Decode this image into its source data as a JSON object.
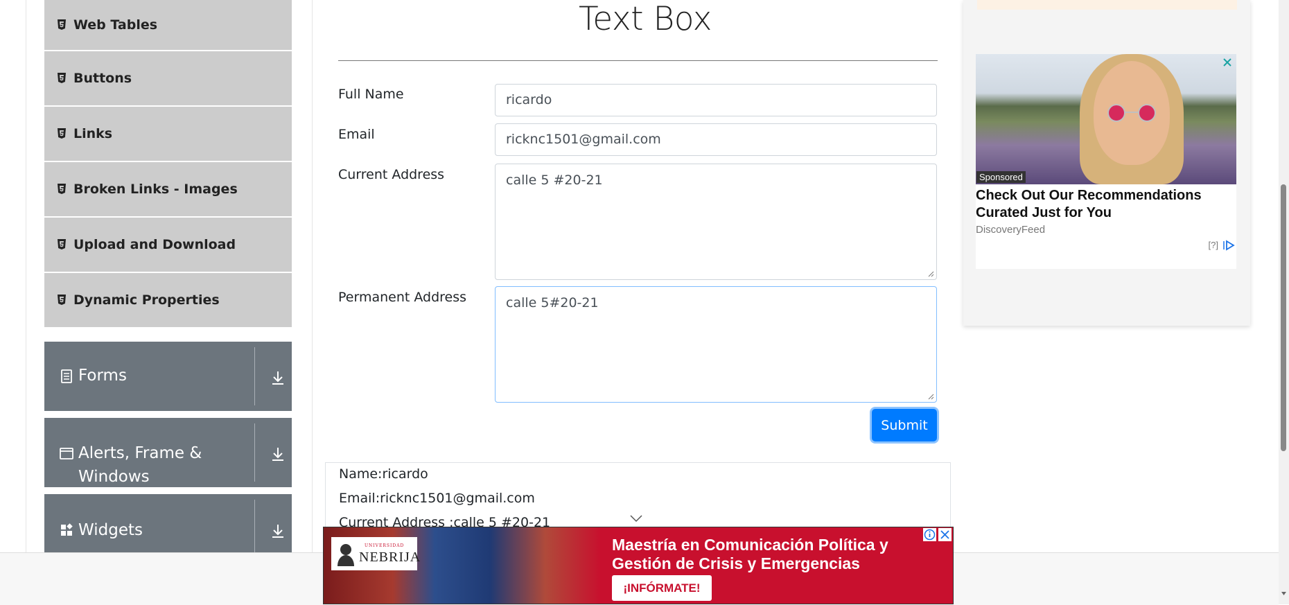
{
  "sidebar": {
    "elements_items": [
      {
        "label": "Web Tables"
      },
      {
        "label": "Buttons"
      },
      {
        "label": "Links"
      },
      {
        "label": "Broken Links - Images"
      },
      {
        "label": "Upload and Download"
      },
      {
        "label": "Dynamic Properties"
      }
    ],
    "groups": [
      {
        "label": "Forms",
        "icon": "form-icon"
      },
      {
        "label": "Alerts, Frame &",
        "label2": "Windows",
        "icon": "window-icon"
      },
      {
        "label": "Widgets",
        "icon": "widgets-icon"
      }
    ]
  },
  "main": {
    "title": "Text Box",
    "form": {
      "full_name_label": "Full Name",
      "full_name_value": "ricardo",
      "email_label": "Email",
      "email_value": "ricknc1501@gmail.com",
      "current_address_label": "Current Address",
      "current_address_value": "calle 5 #20-21",
      "permanent_address_label": "Permanent Address",
      "permanent_address_value": "calle 5#20-21",
      "submit_label": "Submit"
    },
    "output": {
      "name_line": "Name:ricardo",
      "email_line": "Email:ricknc1501@gmail.com",
      "current_address_line": "Current Address :calle 5 #20-21"
    }
  },
  "bottom_ad": {
    "logo_small": "UNIVERSIDAD",
    "logo_name": "NEBRIJA",
    "headline": "Maestría en Comunicación Política y Gestión de Crisis y Emergencias",
    "cta": "¡INFÓRMATE!"
  },
  "side_ad": {
    "badge": "Sponsored",
    "title": "Check Out Our Recommendations Curated Just for You",
    "source": "DiscoveryFeed",
    "help": "[?]"
  },
  "colors": {
    "submit": "#007bff",
    "group_bg": "#6c757d",
    "item_bg": "#cccccc",
    "ad_red": "#c8102e"
  }
}
